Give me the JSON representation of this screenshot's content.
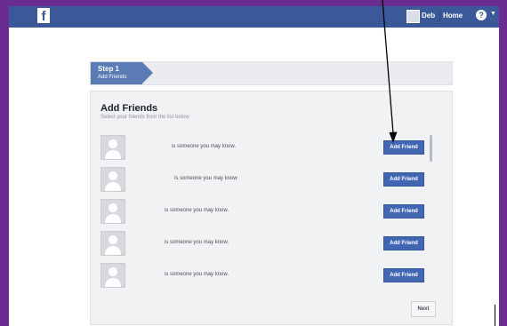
{
  "topbar": {
    "logo": "f",
    "user_name": "Deb",
    "home_label": "Home",
    "help_glyph": "?",
    "menu_caret": "▼",
    "colors": {
      "brand": "#3b5998"
    }
  },
  "wizard": {
    "step_title": "Step 1",
    "step_subtitle": "Add Friends"
  },
  "panel": {
    "title": "Add Friends",
    "subtitle": "Select your friends from the list below",
    "suggestions": [
      {
        "text": "is someone you may know.",
        "button": "Add Friend"
      },
      {
        "text": "is someone you may know",
        "button": "Add Friend"
      },
      {
        "text": "is someone you may know.",
        "button": "Add Friend"
      },
      {
        "text": "is someone you may know.",
        "button": "Add Friend"
      },
      {
        "text": "is someone you may know.",
        "button": "Add Friend"
      }
    ],
    "next_label": "Next"
  },
  "icons": [
    "facebook-logo-icon",
    "user-avatar-icon",
    "help-icon",
    "chevron-down-icon",
    "profile-placeholder-icon"
  ],
  "colors": {
    "frame": "#6a2c91",
    "button": "#4267b2",
    "step_chip": "#5b7bb4"
  }
}
